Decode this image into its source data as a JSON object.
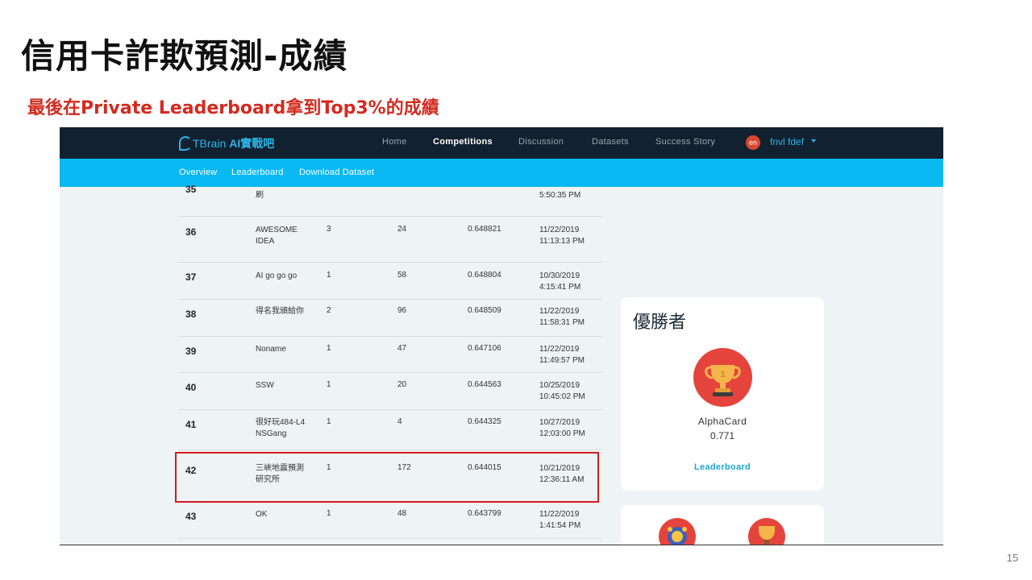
{
  "slide": {
    "title": "信用卡詐欺預測-成績",
    "subtitle": "最後在Private Leaderboard拿到Top3%的成績",
    "page_number": "15"
  },
  "colors": {
    "navbar": "#12212f",
    "subnav": "#0ab8f3",
    "accent": "#2bb5e8",
    "highlight": "#d21d1d",
    "subtitle": "#d42a1f",
    "trophy_bg": "#e5443d"
  },
  "app": {
    "logo_text": "TBrain",
    "logo_ai": "AI實戰吧",
    "nav": [
      "Home",
      "Competitions",
      "Discussion",
      "Datasets",
      "Success Story"
    ],
    "active_nav": "Competitions",
    "lang_badge": "en",
    "user_name": "fnvl fdef",
    "subnav": [
      "Overview",
      "Leaderboard",
      "Download Dataset"
    ]
  },
  "leaderboard": {
    "rows": [
      {
        "rank": "35",
        "team": "刷",
        "members": "",
        "entries": "",
        "score": "",
        "date": "",
        "time": "5:50:35 PM"
      },
      {
        "rank": "36",
        "team": "AWESOME IDEA",
        "members": "3",
        "entries": "24",
        "score": "0.648821",
        "date": "11/22/2019",
        "time": "11:13:13 PM"
      },
      {
        "rank": "37",
        "team": "AI go go go",
        "members": "1",
        "entries": "58",
        "score": "0.648804",
        "date": "10/30/2019",
        "time": "4:15:41 PM"
      },
      {
        "rank": "38",
        "team": "得名我頒給你",
        "members": "2",
        "entries": "96",
        "score": "0.648509",
        "date": "11/22/2019",
        "time": "11:58:31 PM"
      },
      {
        "rank": "39",
        "team": "Noname",
        "members": "1",
        "entries": "47",
        "score": "0.647106",
        "date": "11/22/2019",
        "time": "11:49:57 PM"
      },
      {
        "rank": "40",
        "team": "SSW",
        "members": "1",
        "entries": "20",
        "score": "0.644563",
        "date": "10/25/2019",
        "time": "10:45:02 PM"
      },
      {
        "rank": "41",
        "team": "很好玩484-L4 NSGang",
        "members": "1",
        "entries": "4",
        "score": "0.644325",
        "date": "10/27/2019",
        "time": "12:03:00 PM"
      },
      {
        "rank": "42",
        "team": "三峽地震預測研究所",
        "members": "1",
        "entries": "172",
        "score": "0.644015",
        "date": "10/21/2019",
        "time": "12:36:11 AM"
      },
      {
        "rank": "43",
        "team": "OK",
        "members": "1",
        "entries": "48",
        "score": "0.643799",
        "date": "11/22/2019",
        "time": "1:41:54 PM"
      }
    ]
  },
  "winner": {
    "title": "優勝者",
    "icon": "trophy-icon",
    "name": "AlphaCard",
    "score": "0.771",
    "link": "Leaderboard"
  }
}
